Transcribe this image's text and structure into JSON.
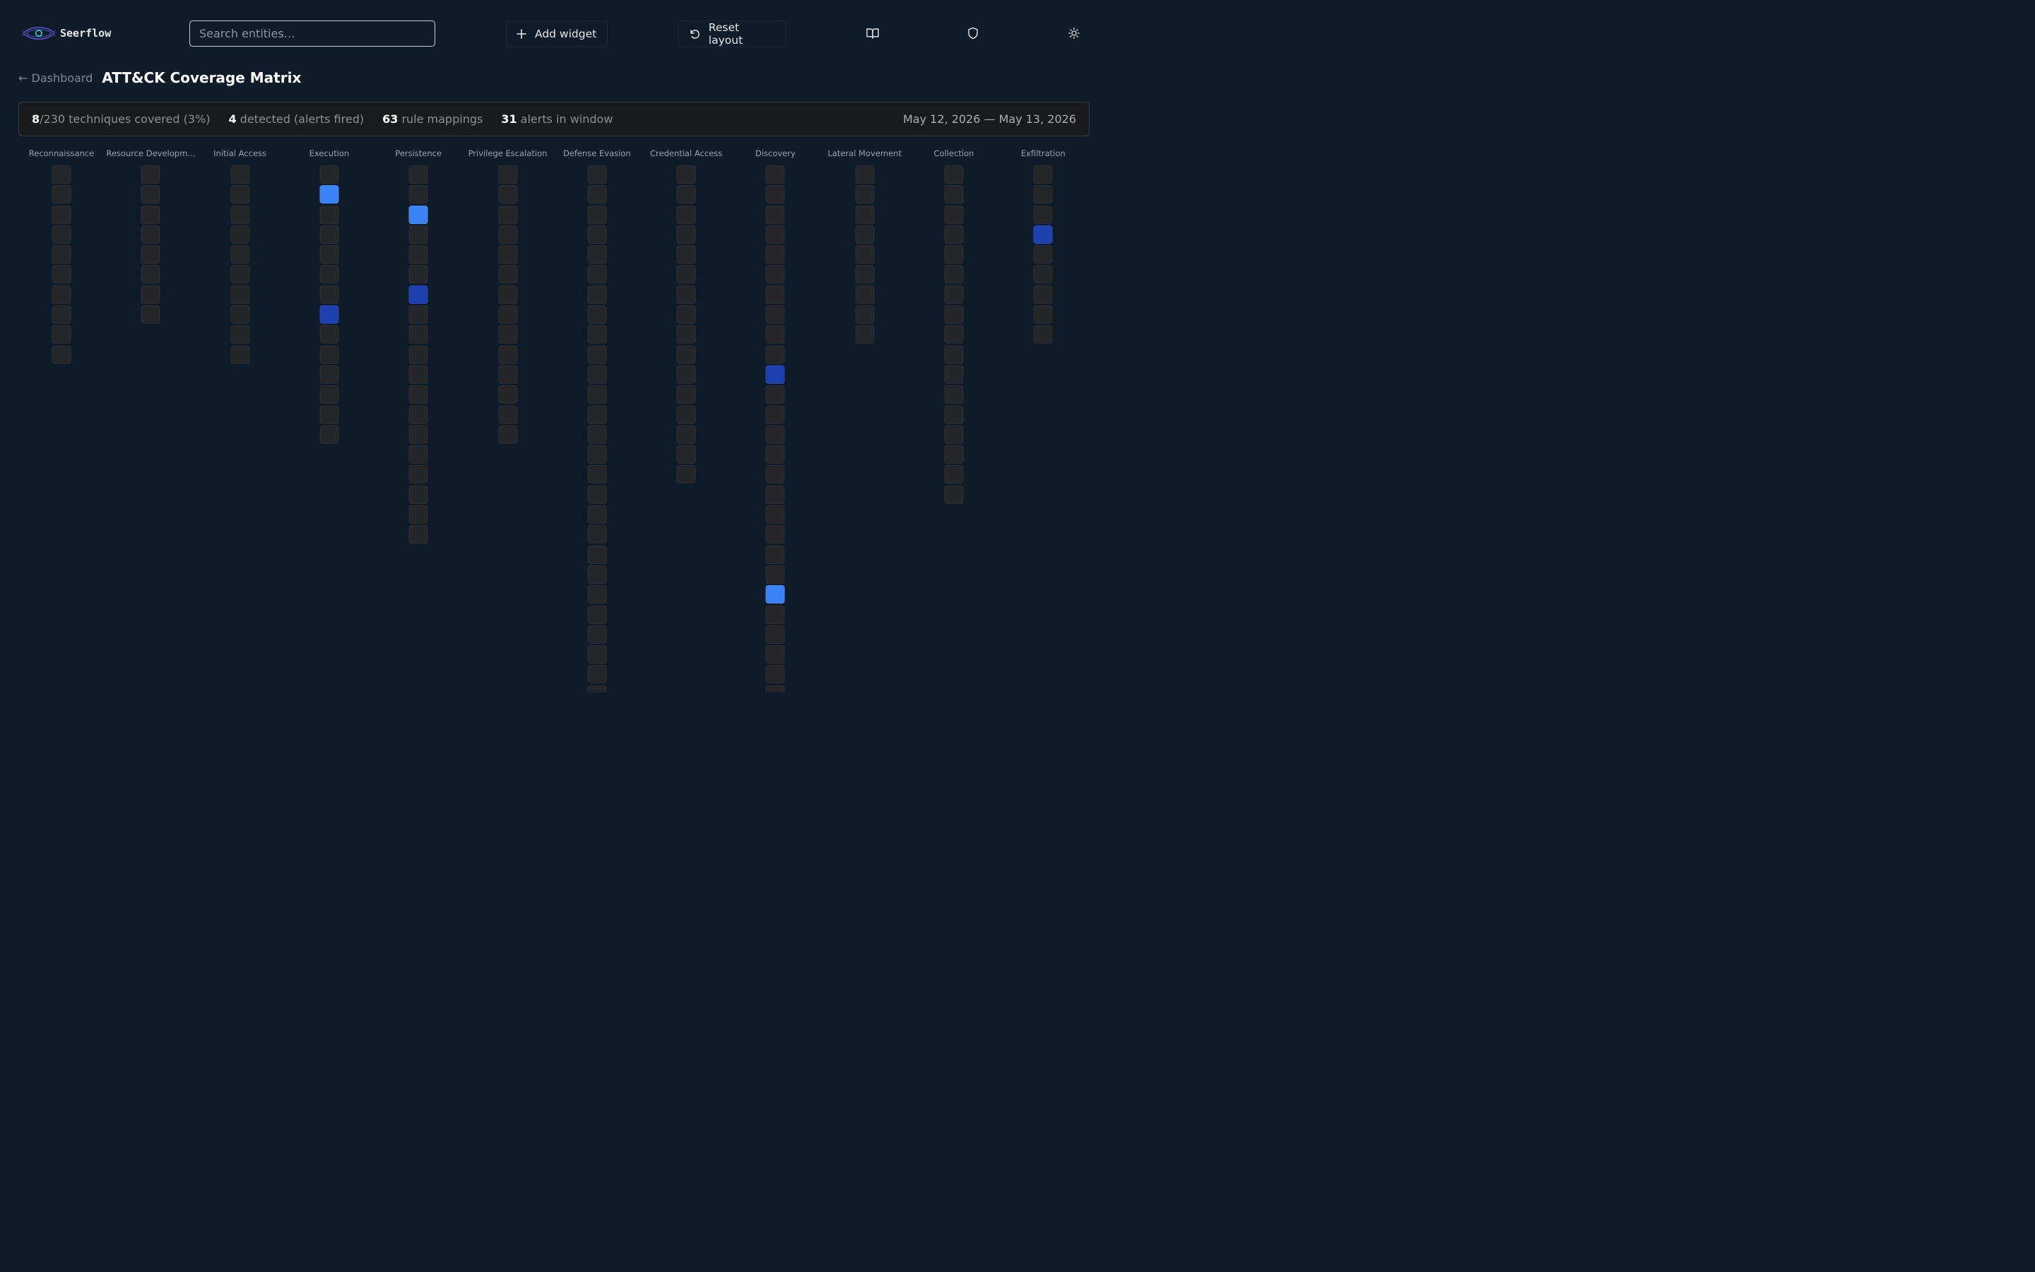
{
  "app": {
    "name": "Seerflow"
  },
  "search": {
    "placeholder": "Search entities…"
  },
  "toolbar": {
    "add_widget_label": "Add widget",
    "reset_layout_label": "Reset layout"
  },
  "icons": {
    "docs": "book-open-icon",
    "security": "shield-icon",
    "theme": "sun-icon",
    "add": "plus-icon",
    "reset": "rotate-ccw-icon"
  },
  "breadcrumb": {
    "back_label": "← Dashboard"
  },
  "page": {
    "title": "ATT&CK Coverage Matrix"
  },
  "stats": {
    "covered_value": "8",
    "covered_text": "/230 techniques covered (3%)",
    "detected_value": "4",
    "detected_text": " detected (alerts fired)",
    "mappings_value": "63",
    "mappings_text": " rule mappings",
    "alerts_value": "31",
    "alerts_text": " alerts in window",
    "date_range": "May 12, 2026 — May 13, 2026"
  },
  "colors": {
    "detected": "#3b82f6",
    "mapped": "#1e40af",
    "uncovered": "#242629",
    "background": "#0e1c29"
  },
  "tactics": [
    {
      "name": "Reconnaissance",
      "count": 10,
      "detected": [],
      "mapped": []
    },
    {
      "name": "Resource Developm...",
      "count": 8,
      "detected": [],
      "mapped": []
    },
    {
      "name": "Initial Access",
      "count": 10,
      "detected": [],
      "mapped": []
    },
    {
      "name": "Execution",
      "count": 14,
      "detected": [
        1
      ],
      "mapped": [
        7
      ]
    },
    {
      "name": "Persistence",
      "count": 19,
      "detected": [
        2
      ],
      "mapped": [
        6
      ]
    },
    {
      "name": "Privilege Escalation",
      "count": 14,
      "detected": [],
      "mapped": []
    },
    {
      "name": "Defense Evasion",
      "count": 27,
      "detected": [],
      "mapped": []
    },
    {
      "name": "Credential Access",
      "count": 16,
      "detected": [],
      "mapped": []
    },
    {
      "name": "Discovery",
      "count": 27,
      "detected": [
        21
      ],
      "mapped": [
        10
      ]
    },
    {
      "name": "Lateral Movement",
      "count": 9,
      "detected": [],
      "mapped": []
    },
    {
      "name": "Collection",
      "count": 17,
      "detected": [],
      "mapped": []
    },
    {
      "name": "Exfiltration",
      "count": 9,
      "detected": [],
      "mapped": [
        3
      ]
    }
  ]
}
